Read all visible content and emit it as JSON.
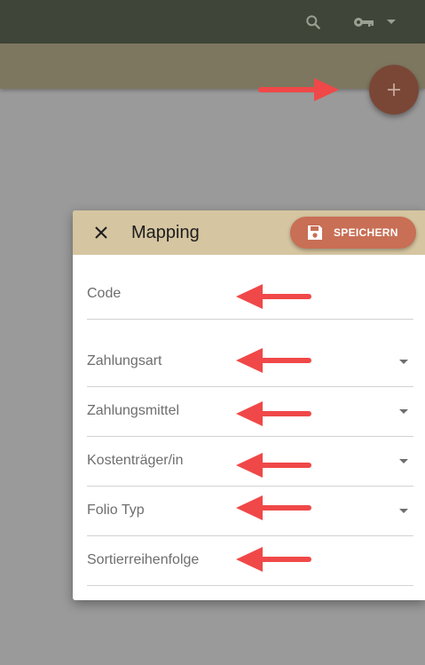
{
  "topbar": {
    "search_icon": "search-icon",
    "account_icon": "key-icon",
    "menu_icon": "chevron-down-icon"
  },
  "fab": {
    "icon": "plus-icon"
  },
  "dialog": {
    "title": "Mapping",
    "close_icon": "close-icon",
    "save_label": "SPEICHERN",
    "save_icon": "save-icon",
    "fields": [
      {
        "label": "Code",
        "type": "text"
      },
      {
        "label": "Zahlungsart",
        "type": "select"
      },
      {
        "label": "Zahlungsmittel",
        "type": "select"
      },
      {
        "label": "Kostenträger/in",
        "type": "select"
      },
      {
        "label": "Folio Typ",
        "type": "select"
      },
      {
        "label": "Sortierreihenfolge",
        "type": "text"
      }
    ]
  },
  "colors": {
    "topbar": "#3f4538",
    "subbar": "#7d7760",
    "fab": "#7a4736",
    "dialog_header": "#d5c5a0",
    "save_button": "#c86f55",
    "annotation_arrow": "#f04848",
    "backdrop": "#9a9a9a"
  }
}
